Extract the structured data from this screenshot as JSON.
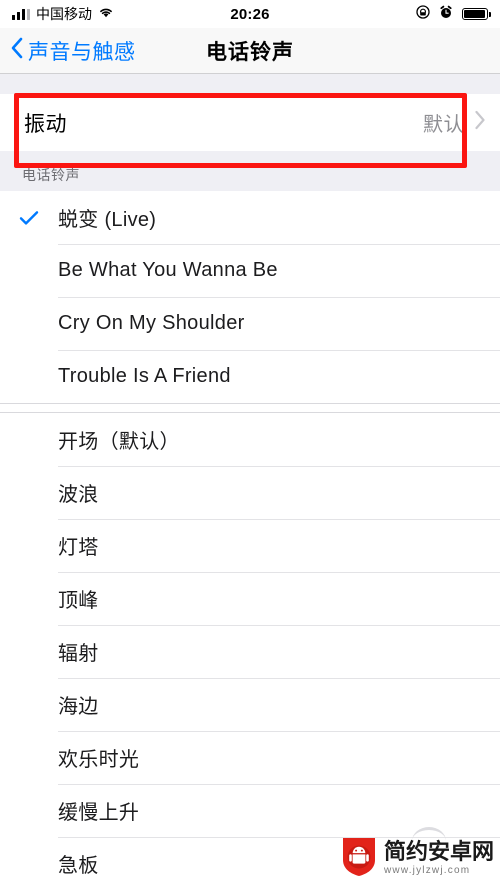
{
  "status_bar": {
    "carrier": "中国移动",
    "time": "20:26",
    "signal_icon": "signal-bars-icon",
    "wifi_icon": "wifi-icon",
    "rotation_lock_icon": "rotation-lock-icon",
    "alarm_icon": "alarm-clock-icon",
    "battery_icon": "battery-icon",
    "battery_level": 95
  },
  "nav": {
    "back_label": "声音与触感",
    "back_icon": "chevron-left-icon",
    "title": "电话铃声"
  },
  "vibration": {
    "title": "振动",
    "value": "默认",
    "disclosure_icon": "chevron-right-icon"
  },
  "ringtones": {
    "section_header": "电话铃声",
    "custom": [
      {
        "label": "蜕变 (Live)",
        "selected": true
      },
      {
        "label": "Be What You Wanna Be",
        "selected": false
      },
      {
        "label": "Cry On My Shoulder",
        "selected": false
      },
      {
        "label": "Trouble Is A Friend",
        "selected": false
      }
    ],
    "system": [
      {
        "label": "开场（默认）",
        "selected": false
      },
      {
        "label": "波浪",
        "selected": false
      },
      {
        "label": "灯塔",
        "selected": false
      },
      {
        "label": "顶峰",
        "selected": false
      },
      {
        "label": "辐射",
        "selected": false
      },
      {
        "label": "海边",
        "selected": false
      },
      {
        "label": "欢乐时光",
        "selected": false
      },
      {
        "label": "缓慢上升",
        "selected": false
      },
      {
        "label": "急板",
        "selected": false
      }
    ],
    "checkmark_icon": "checkmark-icon"
  },
  "annotation": {
    "highlight_color": "#fb1511",
    "target": "vibration-row"
  },
  "watermark": {
    "name": "简约安卓网",
    "url": "www.jylzwj.com",
    "logo_icon": "android-shield-logo-icon"
  },
  "theme": {
    "accent": "#007aff",
    "group_background": "#efeff4",
    "cell_background": "#ffffff",
    "separator": "#e3e3e6",
    "secondary_text": "#8e8e93"
  }
}
